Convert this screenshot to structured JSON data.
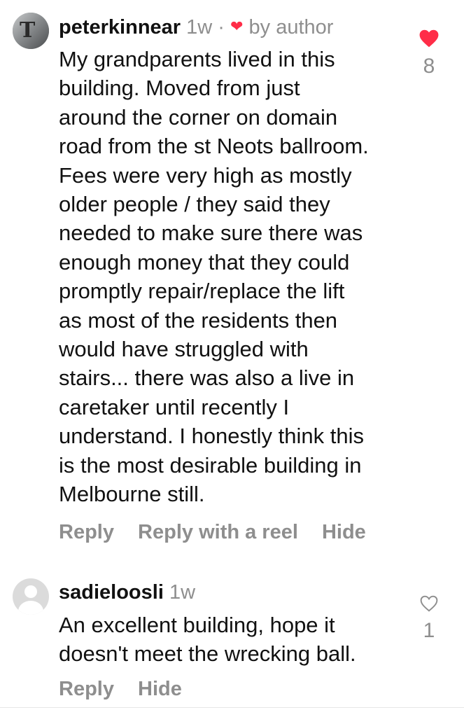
{
  "comments": [
    {
      "username": "peterkinnear",
      "time": "1w",
      "separator": "·",
      "liked_by_author_icon": "heart-icon",
      "by_author": "by author",
      "avatar": "profile-photo",
      "lines": [
        "My grandparents lived in this",
        "building. Moved from just",
        "around the corner on domain",
        "road from the st Neots ballroom.",
        "Fees were very high as mostly",
        "older people / they said they",
        "needed to make sure there was",
        "enough money that they could",
        "promptly repair/replace the lift",
        "as most of the residents then",
        "would have struggled with",
        "stairs... there was also a live in",
        "caretaker until recently I",
        "understand. I honestly think this",
        "is the most desirable building in",
        "Melbourne still."
      ],
      "actions": [
        "Reply",
        "Reply with a reel",
        "Hide"
      ],
      "like_count": "8",
      "liked": true
    },
    {
      "username": "sadieloosli",
      "time": "1w",
      "avatar": "default-avatar",
      "lines": [
        "An excellent building, hope it",
        "doesn't meet the wrecking ball."
      ],
      "actions": [
        "Reply",
        "Hide"
      ],
      "like_count": "1",
      "liked": false
    }
  ],
  "colors": {
    "text": "#111111",
    "secondary": "#8e8e8e",
    "like_red": "#ff2d48",
    "background": "#ffffff"
  }
}
